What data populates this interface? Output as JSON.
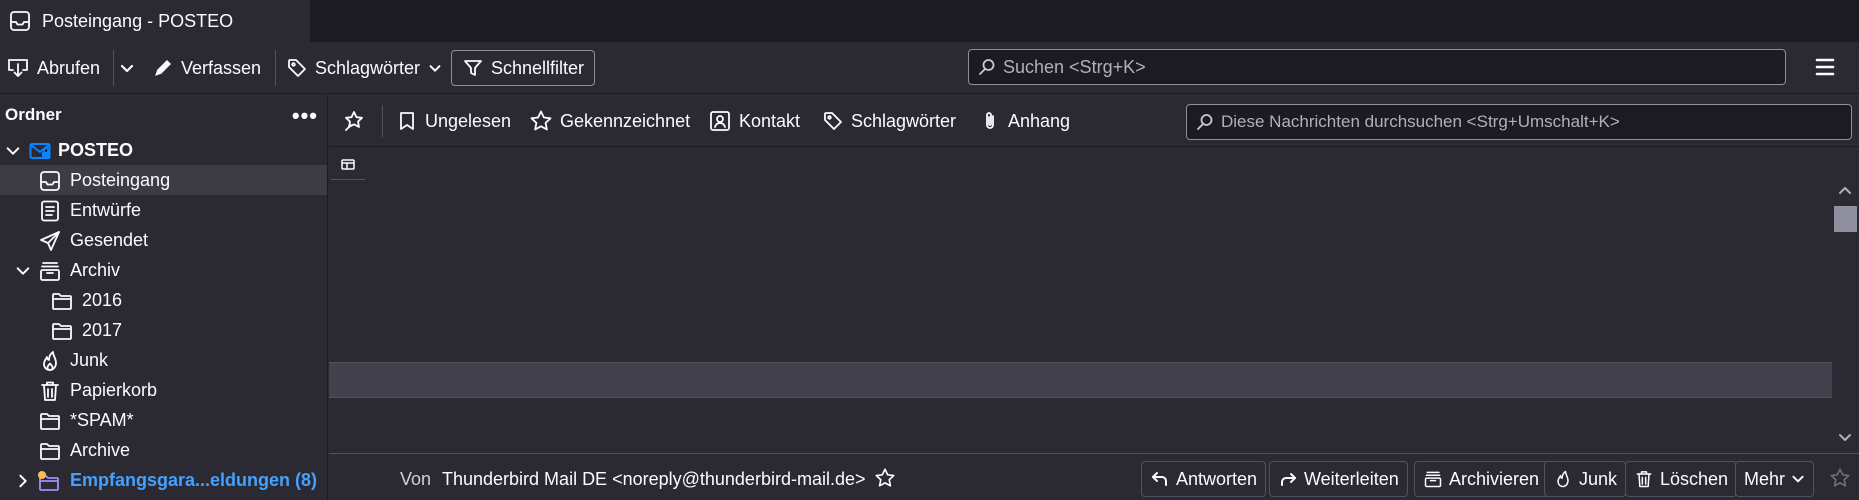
{
  "window": {
    "tab_title": "Posteingang - POSTEO"
  },
  "toolbar": {
    "get_messages": "Abrufen",
    "compose": "Verfassen",
    "tags": "Schlagwörter",
    "quick_filter": "Schnellfilter",
    "search_placeholder": "Suchen <Strg+K>"
  },
  "folders": {
    "header": "Ordner",
    "more": "•••",
    "account": "POSTEO",
    "items": [
      {
        "label": "Posteingang"
      },
      {
        "label": "Entwürfe"
      },
      {
        "label": "Gesendet"
      },
      {
        "label": "Archiv"
      },
      {
        "label": "2016"
      },
      {
        "label": "2017"
      },
      {
        "label": "Junk"
      },
      {
        "label": "Papierkorb"
      },
      {
        "label": "*SPAM*"
      },
      {
        "label": "Archive"
      }
    ],
    "account2": "Empfangsgara...eldungen (8)"
  },
  "quick_filter": {
    "unread": "Ungelesen",
    "starred": "Gekennzeichnet",
    "contact": "Kontakt",
    "tags": "Schlagwörter",
    "attachment": "Anhang",
    "search_placeholder": "Diese Nachrichten durchsuchen <Strg+Umschalt+K>"
  },
  "message_header": {
    "from_label": "Von",
    "from_value": "Thunderbird Mail DE <noreply@thunderbird-mail.de>",
    "reply": "Antworten",
    "forward": "Weiterleiten",
    "archive": "Archivieren",
    "junk": "Junk",
    "delete": "Löschen",
    "more": "Mehr"
  },
  "colors": {
    "background": "#2b2a33",
    "dark": "#1c1b22",
    "accent": "#0a84ff",
    "unread_account": "#45a1ff",
    "text": "#fbfbfe"
  }
}
